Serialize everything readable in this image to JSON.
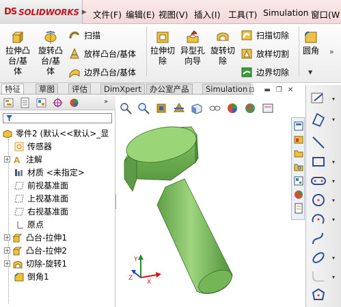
{
  "app": {
    "logo_ds": "DS",
    "logo_text": "SOLIDWORKS"
  },
  "menu": {
    "items": [
      "文件(F)",
      "编辑(E)",
      "视图(V)",
      "插入(I)",
      "工具(T)",
      "Simulation",
      "窗口(W"
    ]
  },
  "ribbon": {
    "extrude_boss": "拉伸凸台/基体",
    "revolve_boss": "旋转凸台/基体",
    "sweep": "扫描",
    "loft_boss": "放样凸台/基体",
    "boundary_boss": "边界凸台/基体",
    "extrude_cut": "拉伸切除",
    "hole_wizard": "异型孔向导",
    "revolve_cut": "旋转切除",
    "sweep_cut": "扫描切除",
    "loft_cut": "放样切割",
    "boundary_cut": "边界切除",
    "fillet": "圆角"
  },
  "tabs": [
    "特征",
    "草图",
    "评估",
    "DimXpert",
    "办公室产品",
    "Simulation"
  ],
  "tree": {
    "root": "零件2 (默认<<默认>_显",
    "items": [
      {
        "label": "传感器",
        "expandable": false
      },
      {
        "label": "注解",
        "expandable": true
      },
      {
        "label": "材质 <未指定>",
        "expandable": false
      },
      {
        "label": "前视基准面",
        "expandable": false
      },
      {
        "label": "上视基准面",
        "expandable": false
      },
      {
        "label": "右视基准面",
        "expandable": false
      },
      {
        "label": "原点",
        "expandable": false
      },
      {
        "label": "凸台-拉伸1",
        "expandable": true
      },
      {
        "label": "凸台-拉伸2",
        "expandable": true
      },
      {
        "label": "切除-旋转1",
        "expandable": true
      },
      {
        "label": "倒角1",
        "expandable": false
      }
    ]
  },
  "triad": {
    "x": "X",
    "y": "Y",
    "z": "Z"
  },
  "colors": {
    "model_green": "#7fbf5f",
    "model_dark": "#4f8f3a",
    "logo_red": "#c4141b",
    "menubar_bg": "#f6e1e1",
    "sketch_blue": "#2b4d9c"
  }
}
